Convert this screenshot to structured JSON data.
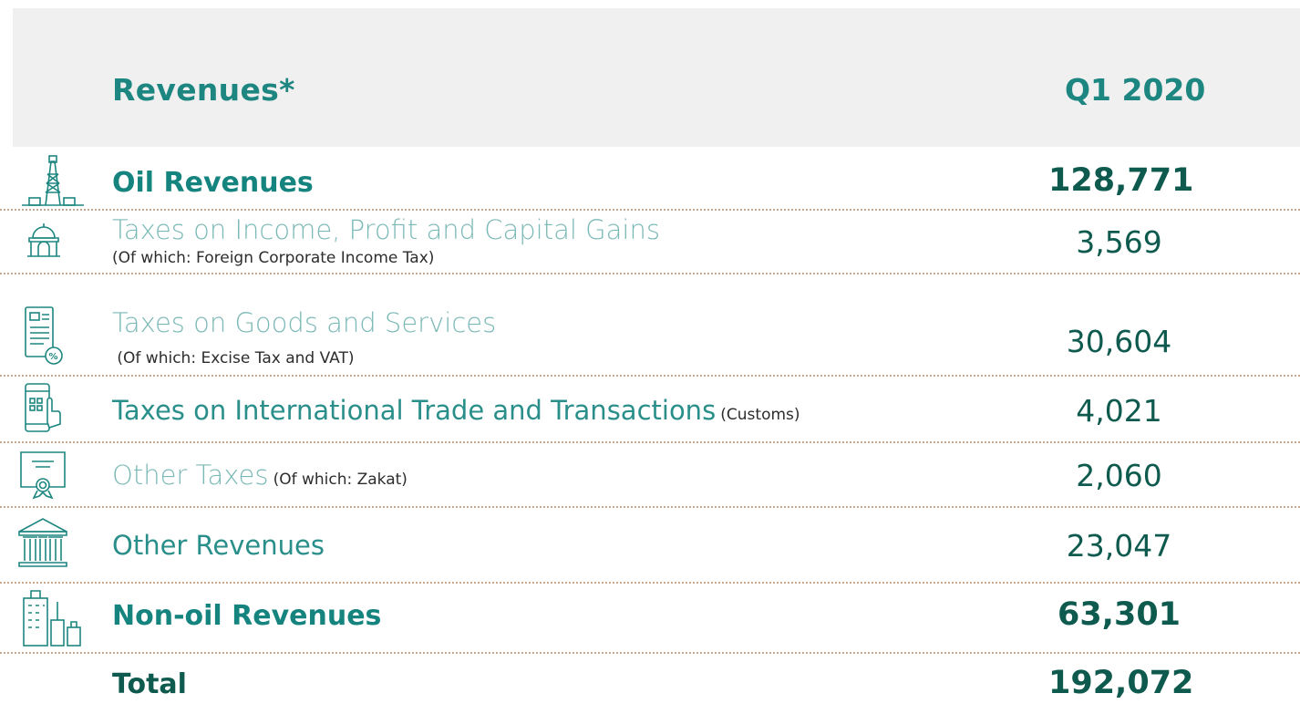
{
  "header": {
    "title": "Revenues*",
    "period": "Q1 2020"
  },
  "rows": [
    {
      "icon": "oil-rig-icon",
      "label": "Oil Revenues",
      "sub": "",
      "value": "128,771"
    },
    {
      "icon": "government-building-icon",
      "label": "Taxes on Income, Profit and Capital Gains",
      "sub": "(Of which: Foreign Corporate Income Tax)",
      "value": "3,569"
    },
    {
      "icon": "tax-invoice-icon",
      "label": "Taxes on Goods and Services",
      "sub": " (Of which: Excise Tax and VAT)",
      "value": "30,604"
    },
    {
      "icon": "tablet-touch-icon",
      "label": "Taxes on International Trade and Transactions",
      "sub": "(Customs)",
      "value": "4,021"
    },
    {
      "icon": "certificate-icon",
      "label": "Other Taxes",
      "sub": "(Of which: Zakat)",
      "value": "2,060"
    },
    {
      "icon": "bank-icon",
      "label": "Other Revenues",
      "sub": "",
      "value": "23,047"
    },
    {
      "icon": "city-buildings-icon",
      "label": "Non-oil Revenues",
      "sub": "",
      "value": "63,301"
    }
  ],
  "total": {
    "label": "Total",
    "value": "192,072"
  },
  "colors": {
    "accent": "#1e8680",
    "dark": "#0f5a4e",
    "light": "#7bb9b6",
    "divider": "#c7a88e",
    "header_bg": "#f0f0f0"
  }
}
